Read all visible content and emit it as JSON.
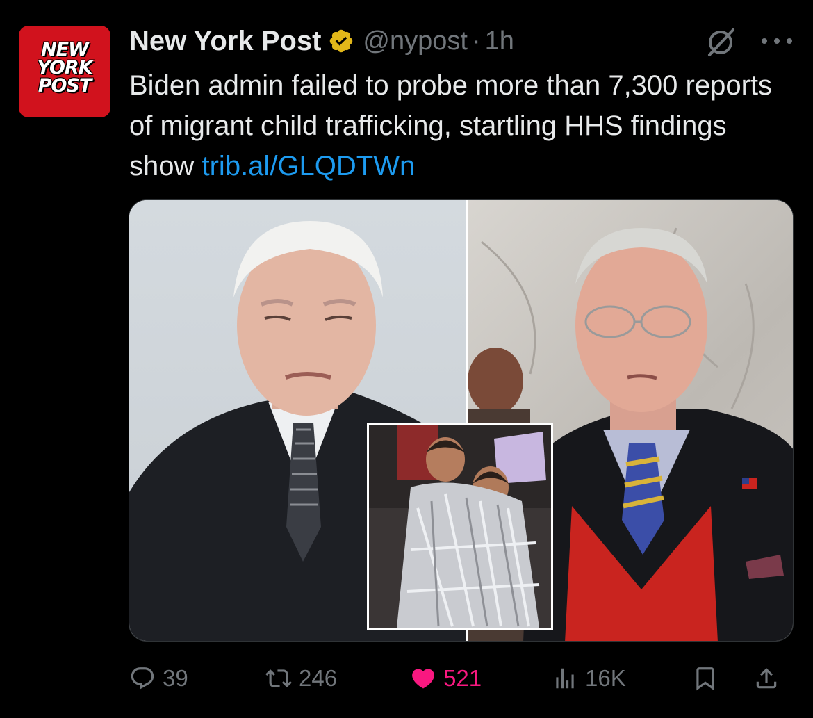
{
  "account": {
    "avatar_lines": [
      "NEW",
      "YORK",
      "POST"
    ],
    "name": "New York Post",
    "handle": "@nypost",
    "separator": "·",
    "time": "1h"
  },
  "tweet": {
    "text": "Biden admin failed to probe more than 7,300 reports of migrant child trafficking, startling HHS findings show ",
    "link": "trib.al/GLQDTWn"
  },
  "actions": {
    "replies": "39",
    "reposts": "246",
    "likes": "521",
    "views": "16K"
  },
  "icons": {
    "verified": "verified-gold-badge-icon",
    "grok": "grok-icon",
    "more": "more-dots-icon",
    "reply": "reply-icon",
    "repost": "repost-icon",
    "like": "heart-icon",
    "views": "views-icon",
    "bookmark": "bookmark-icon",
    "share": "share-icon"
  },
  "colors": {
    "background": "#000000",
    "text": "#e7e9ea",
    "muted": "#71767b",
    "link": "#1d9bf0",
    "like": "#f91880",
    "verified": "#e2b719",
    "brand": "#d1121d"
  }
}
